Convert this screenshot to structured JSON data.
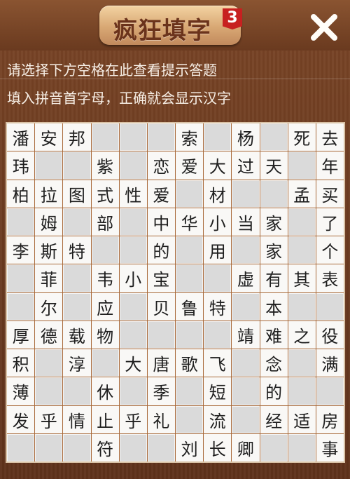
{
  "header": {
    "title": "疯狂填字",
    "level": "3"
  },
  "hints": {
    "line1": "请选择下方空格在此查看提示答题",
    "line2": "填入拼音首字母，正确就会显示汉字"
  },
  "icons": {
    "close": "close-icon"
  },
  "grid": [
    [
      "潘",
      "安",
      "邦",
      "",
      "",
      "",
      "索",
      "",
      "杨",
      "",
      "死",
      "去"
    ],
    [
      "玮",
      "",
      "",
      "紫",
      "",
      "恋",
      "爱",
      "大",
      "过",
      "天",
      "",
      "年"
    ],
    [
      "柏",
      "拉",
      "图",
      "式",
      "性",
      "爱",
      "",
      "材",
      "",
      "",
      "孟",
      "买"
    ],
    [
      "",
      "姆",
      "",
      "部",
      "",
      "中",
      "华",
      "小",
      "当",
      "家",
      "",
      "了"
    ],
    [
      "李",
      "斯",
      "特",
      "",
      "",
      "的",
      "",
      "用",
      "",
      "家",
      "",
      "个"
    ],
    [
      "",
      "菲",
      "",
      "韦",
      "小",
      "宝",
      "",
      "",
      "虚",
      "有",
      "其",
      "表"
    ],
    [
      "",
      "尔",
      "",
      "应",
      "",
      "贝",
      "鲁",
      "特",
      "",
      "本",
      "",
      ""
    ],
    [
      "厚",
      "德",
      "载",
      "物",
      "",
      "",
      "",
      "",
      "靖",
      "难",
      "之",
      "役"
    ],
    [
      "积",
      "",
      "淳",
      "",
      "大",
      "唐",
      "歌",
      "飞",
      "",
      "念",
      "",
      "满"
    ],
    [
      "薄",
      "",
      "",
      "休",
      "",
      "季",
      "",
      "短",
      "",
      "的",
      "",
      ""
    ],
    [
      "发",
      "乎",
      "情",
      "止",
      "乎",
      "礼",
      "",
      "流",
      "",
      "经",
      "适",
      "房"
    ],
    [
      "",
      "",
      "",
      "符",
      "",
      "",
      "刘",
      "长",
      "卿",
      "",
      "",
      "事"
    ]
  ],
  "colors": {
    "background": "#6b3b1f",
    "cell_filled": "#f9f8f6",
    "cell_empty": "#dadada",
    "level_badge": "#c72020"
  }
}
